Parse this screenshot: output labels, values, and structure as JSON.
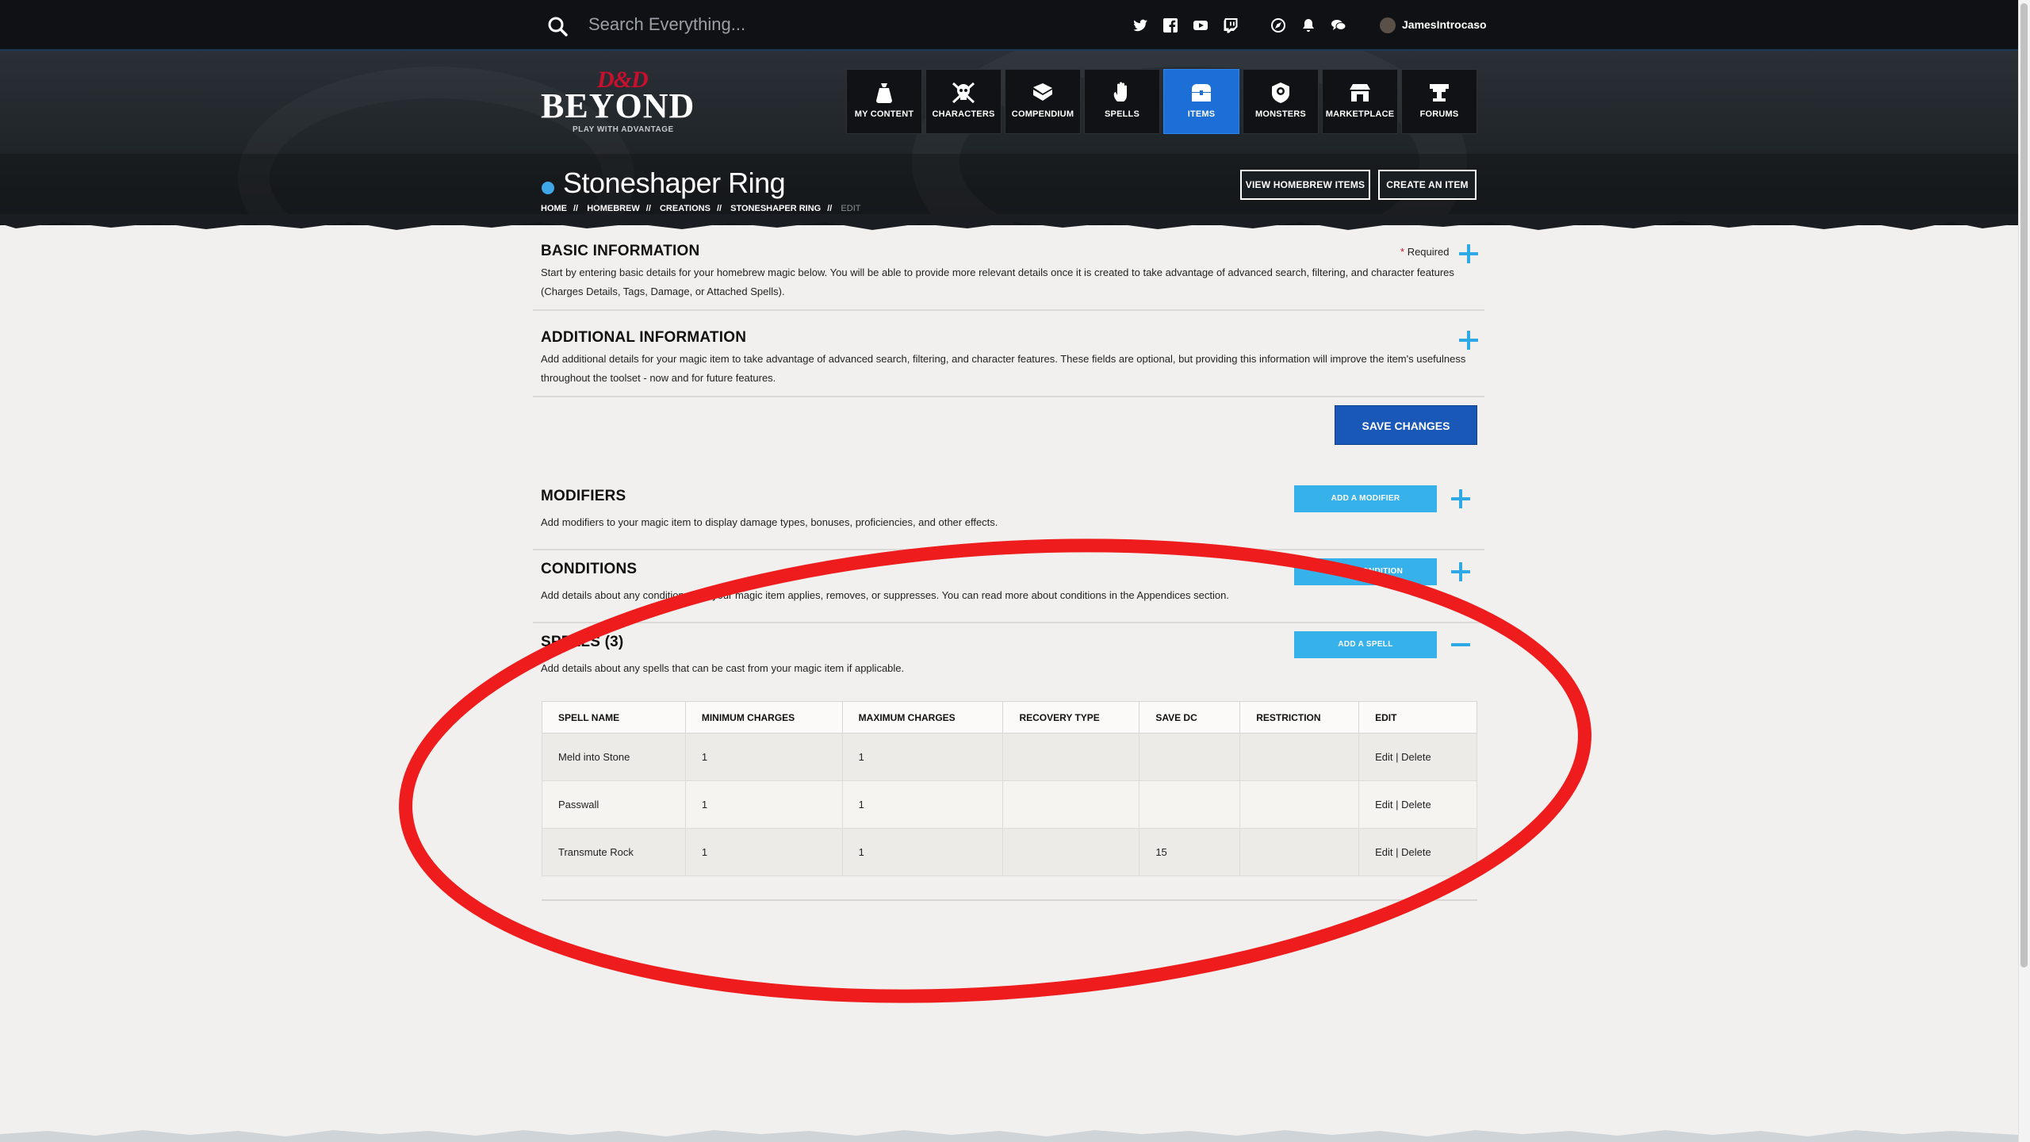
{
  "topbar": {
    "search_placeholder": "Search Everything...",
    "username": "JamesIntrocaso",
    "social_icons": [
      "twitter-icon",
      "facebook-icon",
      "youtube-icon",
      "twitch-icon"
    ],
    "utility_icons": [
      "compass-icon",
      "bell-icon",
      "chat-icon"
    ]
  },
  "logo": {
    "mark": "D&D",
    "wordmark": "BEYOND",
    "tagline": "PLAY WITH ADVANTAGE"
  },
  "nav": [
    {
      "label": "MY CONTENT",
      "icon": "bag-icon"
    },
    {
      "label": "CHARACTERS",
      "icon": "skull-icon"
    },
    {
      "label": "COMPENDIUM",
      "icon": "book-icon"
    },
    {
      "label": "SPELLS",
      "icon": "hand-icon"
    },
    {
      "label": "ITEMS",
      "icon": "chest-icon",
      "active": true
    },
    {
      "label": "MONSTERS",
      "icon": "monster-icon"
    },
    {
      "label": "MARKETPLACE",
      "icon": "shop-icon"
    },
    {
      "label": "FORUMS",
      "icon": "forum-icon"
    }
  ],
  "page": {
    "title": "Stoneshaper Ring",
    "breadcrumb": [
      "HOME",
      "HOMEBREW",
      "CREATIONS",
      "STONESHAPER RING",
      "EDIT"
    ],
    "breadcrumb_sep": "//",
    "btn_view": "VIEW HOMEBREW ITEMS",
    "btn_create": "CREATE AN ITEM"
  },
  "basic": {
    "title": "BASIC INFORMATION",
    "required_star": "*",
    "required_label": "Required",
    "text": "Start by entering basic details for your homebrew magic below. You will be able to provide more relevant details once it is created to take advantage of advanced search, filtering, and character features (Charges Details, Tags, Damage, or Attached Spells)."
  },
  "additional": {
    "title": "ADDITIONAL INFORMATION",
    "text": "Add additional details for your magic item to take advantage of advanced search, filtering, and character features. These fields are optional, but providing this information will improve the item's usefulness throughout the toolset - now and for future features."
  },
  "save_label": "SAVE CHANGES",
  "modifiers": {
    "title": "MODIFIERS",
    "button": "ADD A MODIFIER",
    "text": "Add modifiers to your magic item to display damage types, bonuses, proficiencies, and other effects."
  },
  "conditions": {
    "title": "CONDITIONS",
    "button": "ADD A CONDITION",
    "text": "Add details about any conditions that your magic item applies, removes, or suppresses. You can read more about conditions in the Appendices section."
  },
  "spells": {
    "title": "SPELLS (3)",
    "button": "ADD A SPELL",
    "text": "Add details about any spells that can be cast from your magic item if applicable.",
    "columns": [
      "SPELL NAME",
      "MINIMUM CHARGES",
      "MAXIMUM CHARGES",
      "RECOVERY TYPE",
      "SAVE DC",
      "RESTRICTION",
      "EDIT"
    ],
    "rows": [
      {
        "name": "Meld into Stone",
        "min": "1",
        "max": "1",
        "recovery": "",
        "save_dc": "",
        "restriction": "",
        "edit": "Edit",
        "delete": "Delete"
      },
      {
        "name": "Passwall",
        "min": "1",
        "max": "1",
        "recovery": "",
        "save_dc": "",
        "restriction": "",
        "edit": "Edit",
        "delete": "Delete"
      },
      {
        "name": "Transmute Rock",
        "min": "1",
        "max": "1",
        "recovery": "",
        "save_dc": "15",
        "restriction": "",
        "edit": "Edit",
        "delete": "Delete"
      }
    ],
    "edit_sep": "|"
  },
  "colors": {
    "accent_blue": "#1b6fd6",
    "button_blue": "#1a58b8",
    "light_blue": "#37b1ea",
    "annotation_red": "#ee1c1c",
    "brand_red": "#c8102e"
  }
}
